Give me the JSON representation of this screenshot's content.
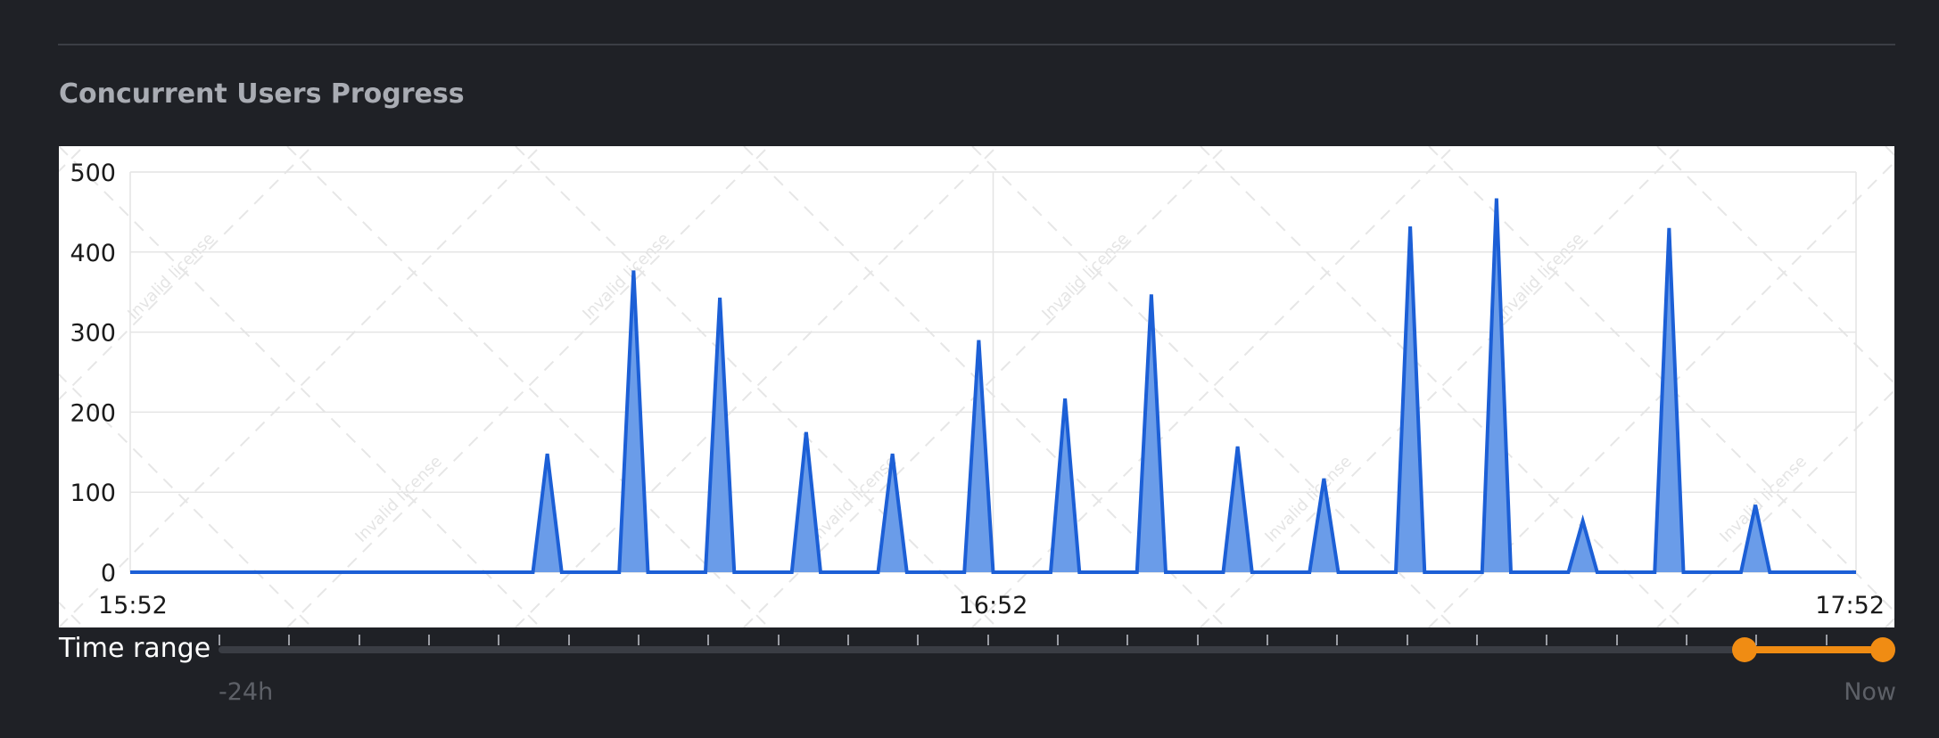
{
  "section": {
    "title": "Concurrent Users Progress"
  },
  "watermark": {
    "text": "Invalid license"
  },
  "time_range": {
    "label": "Time range",
    "min_label": "-24h",
    "max_label": "Now",
    "tick_count": 24,
    "selected_start_fraction": 0.9167,
    "selected_end_fraction": 1.0
  },
  "colors": {
    "background": "#1f2126",
    "series_line": "#1c5fd6",
    "series_fill": "#6a9ce9",
    "accent": "#f08c13"
  },
  "chart_data": {
    "type": "area",
    "title": "Concurrent Users Progress",
    "xlabel": "",
    "ylabel": "",
    "x_ticks": [
      "15:52",
      "16:52",
      "17:52"
    ],
    "y_ticks": [
      0,
      100,
      200,
      300,
      400,
      500
    ],
    "ylim": [
      0,
      500
    ],
    "xlim": [
      "15:52",
      "17:52"
    ],
    "grid": true,
    "legend": "none",
    "series": [
      {
        "x": [
          "15:52",
          "16:19",
          "16:20",
          "16:21",
          "16:22",
          "16:23",
          "16:25",
          "16:26",
          "16:27",
          "16:28",
          "16:29",
          "16:31",
          "16:32",
          "16:33",
          "16:34",
          "16:35",
          "16:37",
          "16:38",
          "16:39",
          "16:40",
          "16:41",
          "16:43",
          "16:44",
          "16:45",
          "16:46",
          "16:47",
          "16:49",
          "16:50",
          "16:51",
          "16:52",
          "16:53",
          "16:55",
          "16:56",
          "16:57",
          "16:58",
          "16:59",
          "17:01",
          "17:02",
          "17:03",
          "17:04",
          "17:05",
          "17:07",
          "17:08",
          "17:09",
          "17:10",
          "17:11",
          "17:13",
          "17:14",
          "17:15",
          "17:16",
          "17:17",
          "17:19",
          "17:20",
          "17:21",
          "17:22",
          "17:23",
          "17:25",
          "17:26",
          "17:27",
          "17:28",
          "17:29",
          "17:31",
          "17:32",
          "17:33",
          "17:34",
          "17:35",
          "17:37",
          "17:38",
          "17:39",
          "17:40",
          "17:41",
          "17:43",
          "17:44",
          "17:45",
          "17:46",
          "17:47",
          "17:52"
        ],
        "values": [
          0,
          0,
          0,
          148,
          0,
          0,
          0,
          0,
          377,
          0,
          0,
          0,
          0,
          343,
          0,
          0,
          0,
          0,
          175,
          0,
          0,
          0,
          0,
          148,
          0,
          0,
          0,
          0,
          290,
          0,
          0,
          0,
          0,
          217,
          0,
          0,
          0,
          0,
          347,
          0,
          0,
          0,
          0,
          157,
          0,
          0,
          0,
          0,
          117,
          0,
          0,
          0,
          0,
          432,
          0,
          0,
          0,
          0,
          467,
          0,
          0,
          0,
          0,
          64,
          0,
          0,
          0,
          0,
          430,
          0,
          0,
          0,
          0,
          84,
          0,
          0,
          0
        ]
      }
    ]
  }
}
